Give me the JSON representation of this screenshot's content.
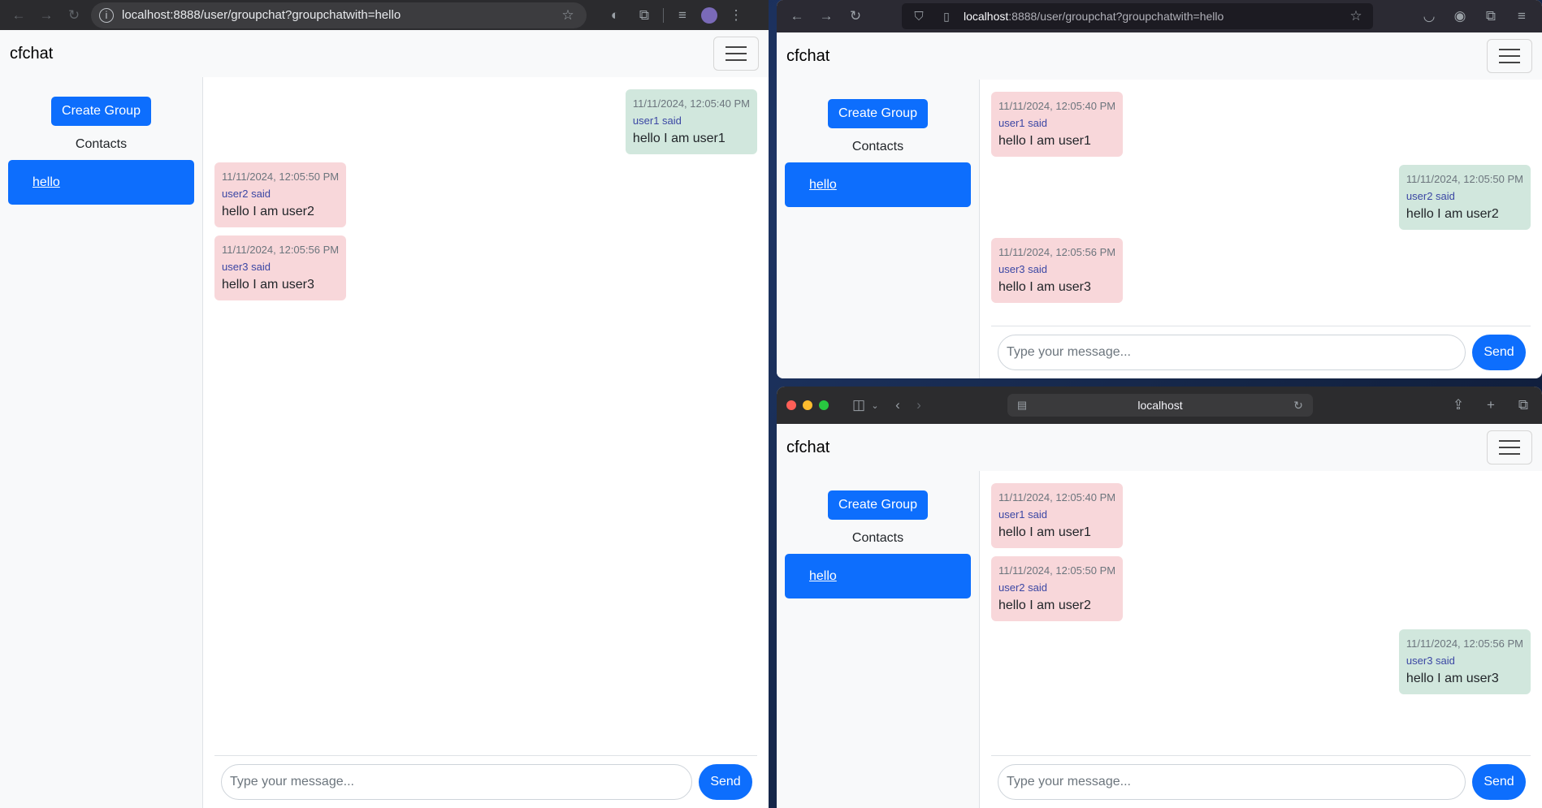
{
  "browsers": {
    "chrome": {
      "url_host": "localhost",
      "url_rest": ":8888/user/groupchat?groupchatwith=hello"
    },
    "firefox": {
      "url_host": "localhost",
      "url_rest": ":8888/user/groupchat?groupchatwith=hello"
    },
    "safari": {
      "url": "localhost"
    }
  },
  "app": {
    "brand": "cfchat",
    "create_group_label": "Create Group",
    "contacts_title": "Contacts",
    "contact_name": "hello",
    "composer_placeholder": "Type your message...",
    "send_label": "Send"
  },
  "windows": [
    {
      "browser": "chrome",
      "messages": [
        {
          "time": "11/11/2024, 12:05:40 PM",
          "sender": "user1 said",
          "text": "hello I am user1",
          "side": "sent"
        },
        {
          "time": "11/11/2024, 12:05:50 PM",
          "sender": "user2 said",
          "text": "hello I am user2",
          "side": "received"
        },
        {
          "time": "11/11/2024, 12:05:56 PM",
          "sender": "user3 said",
          "text": "hello I am user3",
          "side": "received"
        }
      ]
    },
    {
      "browser": "firefox",
      "messages": [
        {
          "time": "11/11/2024, 12:05:40 PM",
          "sender": "user1 said",
          "text": "hello I am user1",
          "side": "received"
        },
        {
          "time": "11/11/2024, 12:05:50 PM",
          "sender": "user2 said",
          "text": "hello I am user2",
          "side": "sent"
        },
        {
          "time": "11/11/2024, 12:05:56 PM",
          "sender": "user3 said",
          "text": "hello I am user3",
          "side": "received"
        }
      ]
    },
    {
      "browser": "safari",
      "messages": [
        {
          "time": "11/11/2024, 12:05:40 PM",
          "sender": "user1 said",
          "text": "hello I am user1",
          "side": "received"
        },
        {
          "time": "11/11/2024, 12:05:50 PM",
          "sender": "user2 said",
          "text": "hello I am user2",
          "side": "received"
        },
        {
          "time": "11/11/2024, 12:05:56 PM",
          "sender": "user3 said",
          "text": "hello I am user3",
          "side": "sent"
        }
      ]
    }
  ],
  "colors": {
    "primary": "#0d6efd",
    "sent_bubble": "#d1e7dd",
    "received_bubble": "#f8d7da",
    "sender_text": "#3b47a4"
  }
}
